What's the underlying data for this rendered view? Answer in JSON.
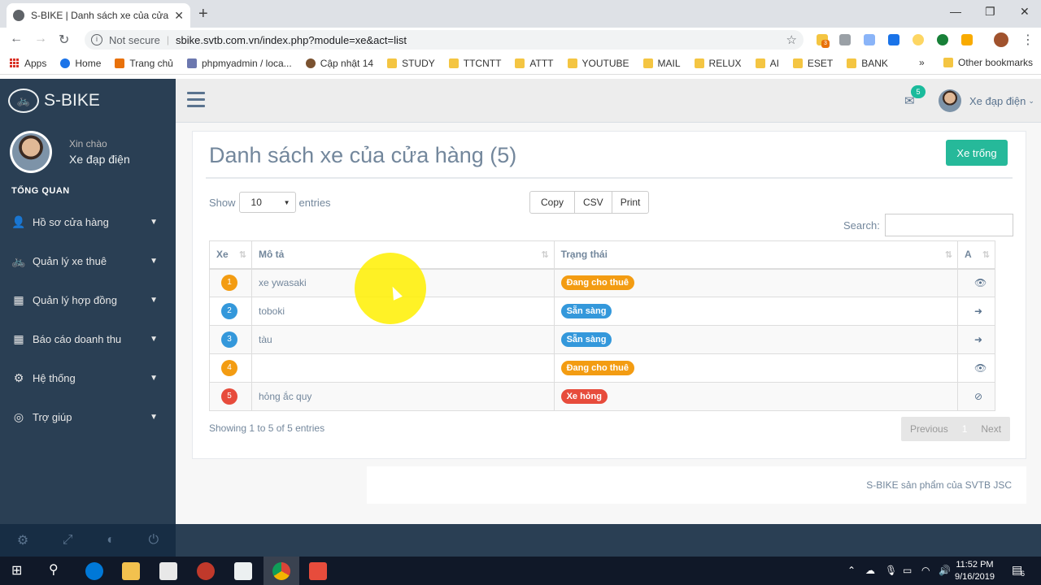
{
  "browser": {
    "tab_title": "S-BIKE | Danh sách xe của cửa hà",
    "security_label": "Not secure",
    "url": "sbike.svtb.com.vn/index.php?module=xe&act=list",
    "bookmarks": [
      "Apps",
      "Home",
      "Trang chủ",
      "phpmyadmin / loca...",
      "Cập nhật 14",
      "STUDY",
      "TTCNTT",
      "ATTT",
      "YOUTUBE",
      "MAIL",
      "RELUX",
      "AI",
      "ESET",
      "BANK"
    ],
    "more": "»",
    "other_bookmarks": "Other bookmarks",
    "extension_badge": "3"
  },
  "sidebar": {
    "brand": "S-BIKE",
    "greeting": "Xin chào",
    "user": "Xe đạp điện",
    "section": "TỔNG QUAN",
    "items": [
      {
        "label": "Hồ sơ cửa hàng",
        "icon": "user-icon"
      },
      {
        "label": "Quản lý xe thuê",
        "icon": "bicycle-icon"
      },
      {
        "label": "Quản lý hợp đồng",
        "icon": "qrcode-icon"
      },
      {
        "label": "Báo cáo doanh thu",
        "icon": "qrcode-icon"
      },
      {
        "label": "Hệ thống",
        "icon": "gear-icon"
      },
      {
        "label": "Trợ giúp",
        "icon": "lifebuoy-icon"
      }
    ]
  },
  "topnav": {
    "mail_count": "5",
    "user": "Xe đạp điện"
  },
  "main": {
    "title": "Danh sách xe của cửa hàng (5)",
    "free_button": "Xe trống",
    "show": "Show",
    "entries_value": "10",
    "entries": "entries",
    "export_buttons": [
      "Copy",
      "CSV",
      "Print"
    ],
    "search_label": "Search:",
    "columns": [
      "Xe",
      "Mô tả",
      "Trạng thái",
      "A"
    ],
    "rows": [
      {
        "num": "1",
        "num_color": "#f39c12",
        "desc": "xe ywasaki",
        "status": "Đang cho thuê",
        "status_color": "#f39c12",
        "action": "eye-icon"
      },
      {
        "num": "2",
        "num_color": "#3498db",
        "desc": "toboki",
        "status": "Sẵn sàng",
        "status_color": "#3498db",
        "action": "sign-in-icon"
      },
      {
        "num": "3",
        "num_color": "#3498db",
        "desc": "tàu",
        "status": "Sẵn sàng",
        "status_color": "#3498db",
        "action": "sign-in-icon"
      },
      {
        "num": "4",
        "num_color": "#f39c12",
        "desc": "",
        "status": "Đang cho thuê",
        "status_color": "#f39c12",
        "action": "eye-icon"
      },
      {
        "num": "5",
        "num_color": "#e74c3c",
        "desc": "hỏng ắc quy",
        "status": "Xe hỏng",
        "status_color": "#e74c3c",
        "action": "ban-icon"
      }
    ],
    "info": "Showing 1 to 5 of 5 entries",
    "pager": {
      "previous": "Previous",
      "current": "1",
      "next": "Next"
    },
    "footer": "S-BIKE sản phẩm của SVTB JSC"
  },
  "taskbar": {
    "time": "11:52 PM",
    "date": "9/16/2019",
    "notifications": "6"
  }
}
